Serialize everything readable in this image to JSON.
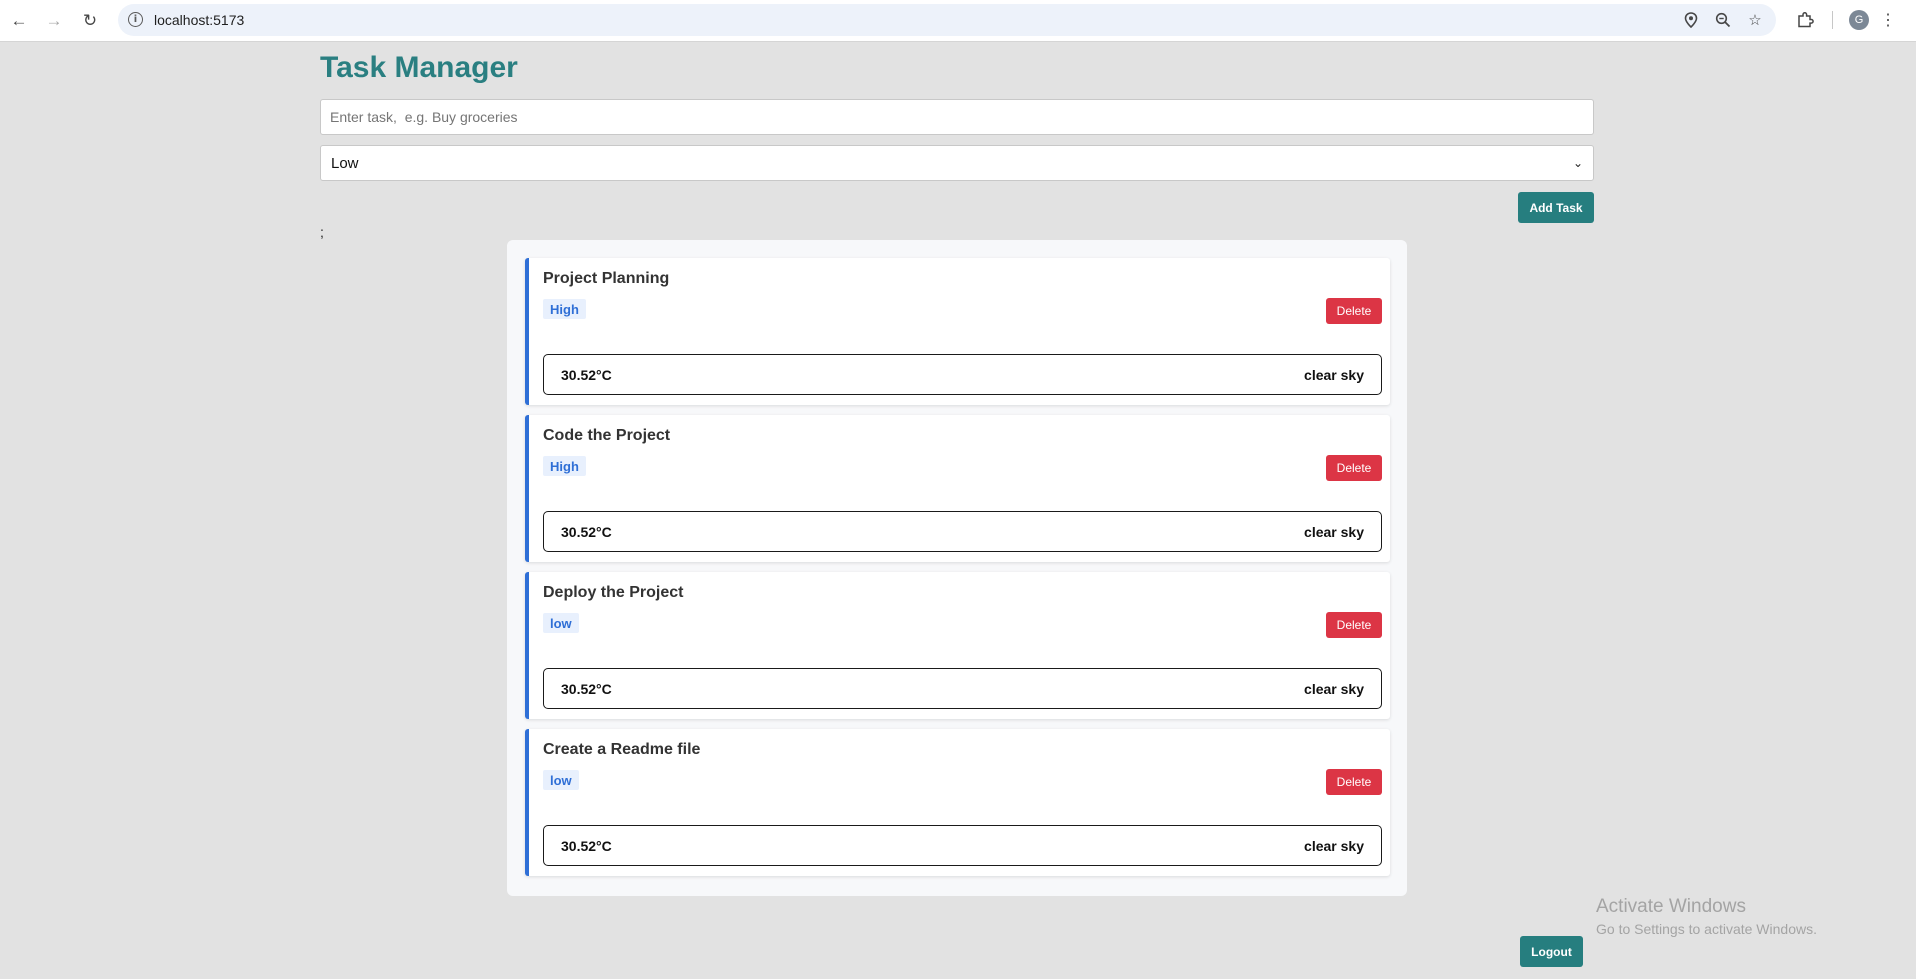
{
  "browser": {
    "url": "localhost:5173",
    "profile_initial": "G",
    "icons": [
      "back-arrow-icon",
      "forward-arrow-icon",
      "reload-icon",
      "site-info-icon",
      "location-icon",
      "zoom-icon",
      "bookmark-star-icon",
      "extensions-icon",
      "kebab-menu-icon"
    ]
  },
  "app": {
    "title": "Task Manager",
    "task_input_placeholder": "Enter task,  e.g. Buy groceries",
    "priority_selected": "Low",
    "add_button": "Add Task",
    "stray_text": ";",
    "logout_button": "Logout"
  },
  "tasks": [
    {
      "name": "Project Planning",
      "priority": "High",
      "delete_label": "Delete",
      "temperature": "30.52°C",
      "condition": "clear sky"
    },
    {
      "name": "Code the Project",
      "priority": "High",
      "delete_label": "Delete",
      "temperature": "30.52°C",
      "condition": "clear sky"
    },
    {
      "name": "Deploy the Project",
      "priority": "low",
      "delete_label": "Delete",
      "temperature": "30.52°C",
      "condition": "clear sky"
    },
    {
      "name": "Create a Readme file",
      "priority": "low",
      "delete_label": "Delete",
      "temperature": "30.52°C",
      "condition": "clear sky"
    }
  ],
  "watermark": {
    "title": "Activate Windows",
    "subtitle": "Go to Settings to activate Windows."
  },
  "colors": {
    "accent_teal": "#267e7f",
    "title_teal": "#2a7f81",
    "delete_red": "#dc3545",
    "priority_blue": "#2f6fd6"
  }
}
